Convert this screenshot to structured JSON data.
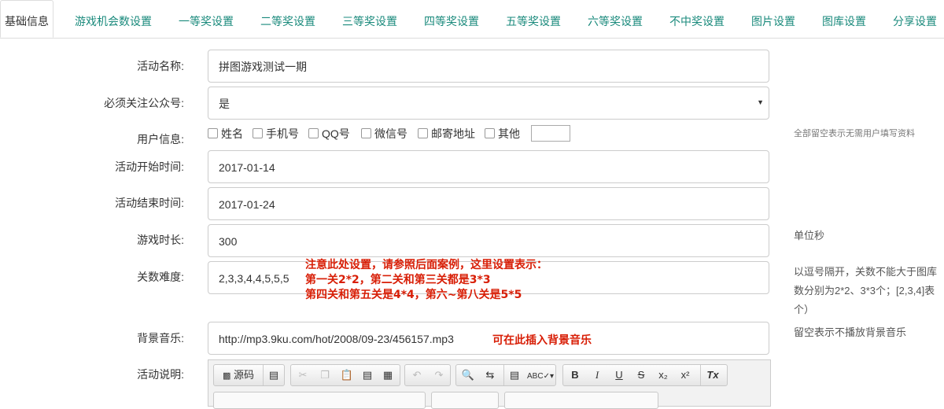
{
  "tabs": [
    {
      "label": "基础信息",
      "active": true
    },
    {
      "label": "游戏机会数设置"
    },
    {
      "label": "一等奖设置"
    },
    {
      "label": "二等奖设置"
    },
    {
      "label": "三等奖设置"
    },
    {
      "label": "四等奖设置"
    },
    {
      "label": "五等奖设置"
    },
    {
      "label": "六等奖设置"
    },
    {
      "label": "不中奖设置"
    },
    {
      "label": "图片设置"
    },
    {
      "label": "图库设置"
    },
    {
      "label": "分享设置"
    }
  ],
  "form": {
    "name": {
      "label": "活动名称:",
      "value": "拼图游戏测试一期"
    },
    "follow": {
      "label": "必须关注公众号:",
      "value": "是"
    },
    "userinfo": {
      "label": "用户信息:",
      "options": [
        "姓名",
        "手机号",
        "QQ号",
        "微信号",
        "邮寄地址",
        "其他"
      ],
      "help": "全部留空表示无需用户填写资料"
    },
    "start": {
      "label": "活动开始时间:",
      "value": "2017-01-14"
    },
    "end": {
      "label": "活动结束时间:",
      "value": "2017-01-24"
    },
    "duration": {
      "label": "游戏时长:",
      "value": "300",
      "help": "单位秒"
    },
    "levels": {
      "label": "关数难度:",
      "value": "2,3,3,4,4,5,5,5",
      "help_lines": [
        "以逗号隔开，关数不能大于图库",
        "数分别为2*2、3*3个；[2,3,4]表",
        "个）"
      ],
      "note_lines": [
        "注意此处设置，请参照后面案例，这里设置表示：",
        "第一关2*2，第二关和第三关都是3*3",
        "第四关和第五关是4*4，第六~第八关是5*5"
      ]
    },
    "music": {
      "label": "背景音乐:",
      "value": "http://mp3.9ku.com/hot/2008/09-23/456157.mp3",
      "note": "可在此插入背景音乐",
      "help": "留空表示不播放背景音乐"
    },
    "desc": {
      "label": "活动说明:"
    }
  },
  "editor": {
    "source_label": "源码",
    "buttons": [
      "B",
      "I",
      "U",
      "S",
      "x₂",
      "x²",
      "Tx"
    ]
  }
}
